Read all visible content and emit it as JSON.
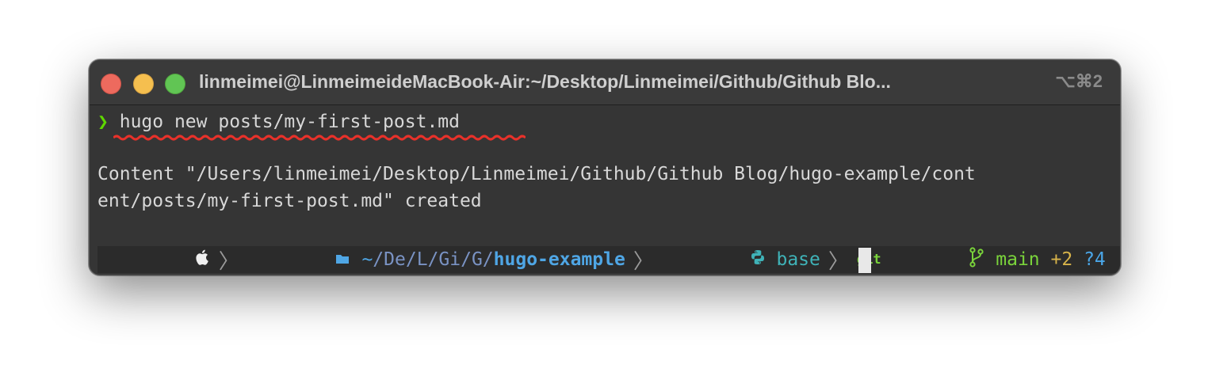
{
  "window": {
    "title": "linmeimei@LinmeimeideMacBook-Air:~/Desktop/Linmeimei/Github/Github Blo...",
    "shortcut": "⌥⌘2",
    "traffic_lights": {
      "close": "#ed6a5e",
      "minimize": "#f5bf4f",
      "maximize": "#61c554"
    }
  },
  "terminal": {
    "prompt_symbol": "❯",
    "command": "hugo new posts/my-first-post.md",
    "output_line1": "Content \"/Users/linmeimei/Desktop/Linmeimei/Github/Github Blog/hugo-example/cont",
    "output_line2": "ent/posts/my-first-post.md\" created",
    "annotation_color": "#e8312a"
  },
  "prompt_bar": {
    "apple_icon": "",
    "folder_icon": "🗁",
    "path_tilde": "~",
    "path_parts": [
      "/De",
      "/L",
      "/Gi",
      "/G",
      "/"
    ],
    "path_current": "hugo-example",
    "python_icon": "python-icon",
    "env": "base",
    "git_label": "git",
    "branch_icon": "branch-icon",
    "branch": "main",
    "staged": "+2",
    "untracked": "?4"
  }
}
